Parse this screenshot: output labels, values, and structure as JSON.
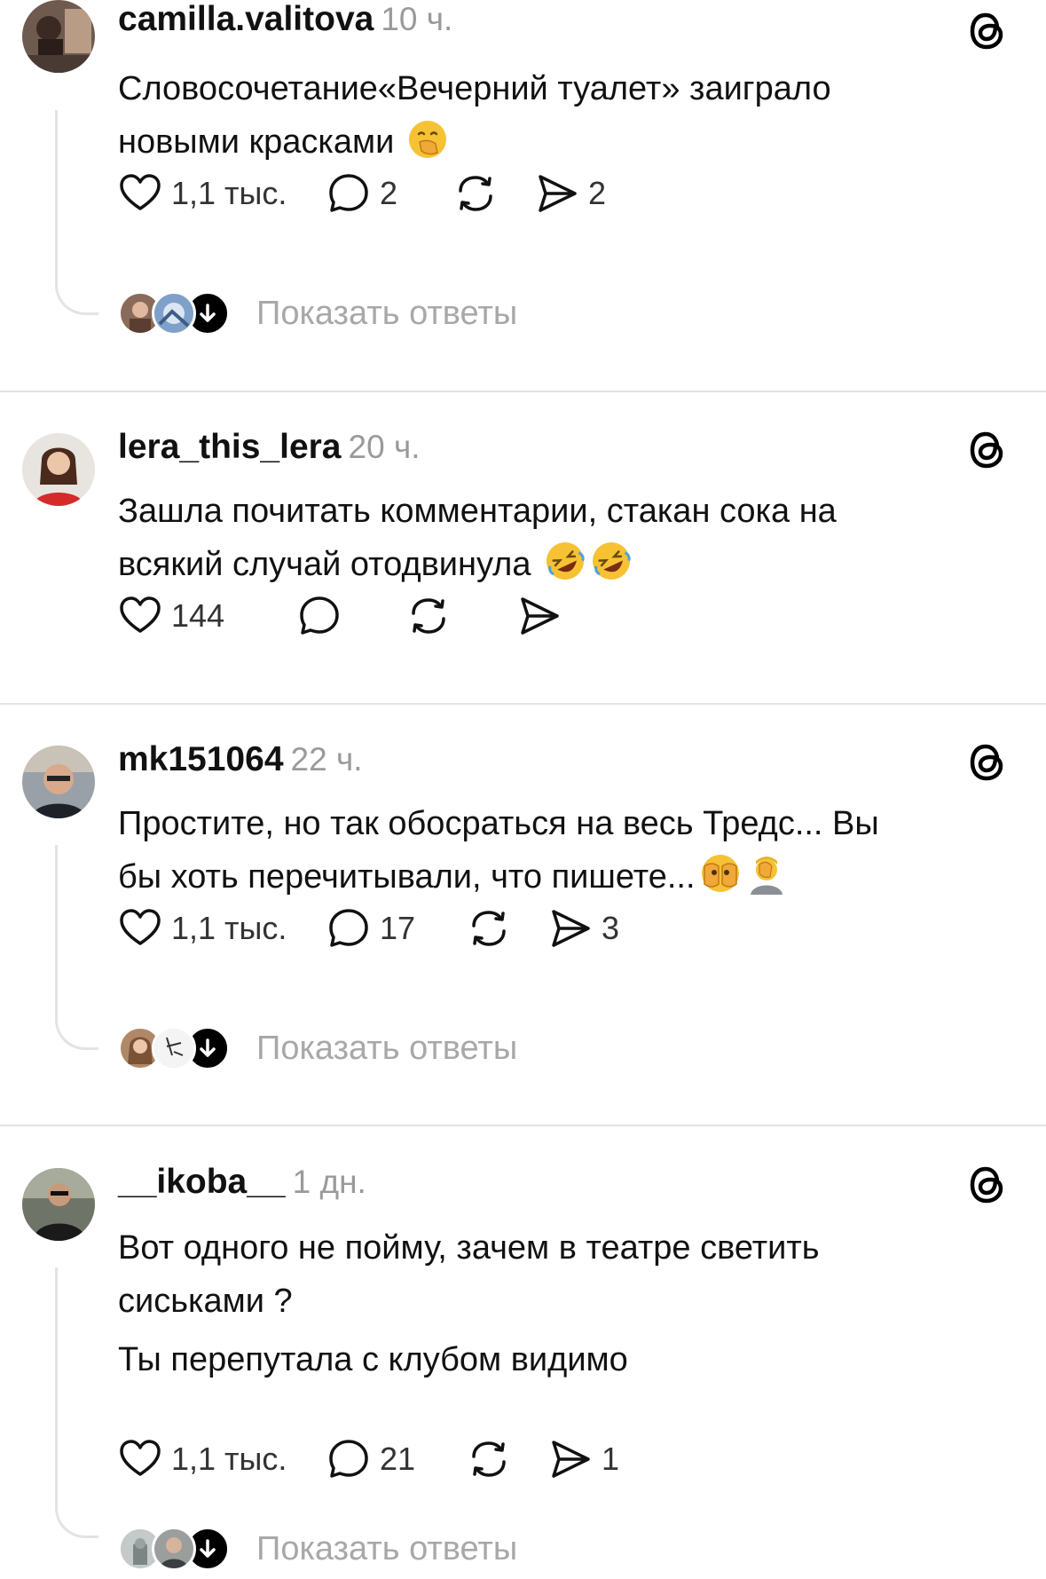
{
  "posts": [
    {
      "username": "camilla.valitova",
      "time": "10 ч.",
      "lines": [
        "Словосочетание«Вечерний туалет» заиграло",
        "новыми красками"
      ],
      "emojis": [
        "hand-over-mouth-emoji"
      ],
      "likes": "1,1 тыс.",
      "comments": "2",
      "reposts": "",
      "shares": "2",
      "show_replies": "Показать ответы"
    },
    {
      "username": "lera_this_lera",
      "time": "20 ч.",
      "lines": [
        "Зашла почитать комментарии, стакан сока на",
        "всякий случай отодвинула"
      ],
      "emojis": [
        "rolling-laughing-emoji",
        "rolling-laughing-emoji"
      ],
      "likes": "144",
      "comments": "",
      "reposts": "",
      "shares": ""
    },
    {
      "username": "mk151064",
      "time": "22 ч.",
      "lines": [
        "Простите, но так обосраться на весь Тредс... Вы",
        "бы хоть перечитывали, что пишете..."
      ],
      "emojis": [
        "face-peeking-emoji",
        "facepalm-emoji"
      ],
      "likes": "1,1 тыс.",
      "comments": "17",
      "reposts": "",
      "shares": "3",
      "show_replies": "Показать ответы"
    },
    {
      "username": "__ikoba__",
      "time": "1 дн.",
      "lines": [
        "Вот одного не пойму, зачем в театре светить",
        "сиськами ?",
        "Ты перепутала с клубом видимо"
      ],
      "emojis": [],
      "likes": "1,1 тыс.",
      "comments": "21",
      "reposts": "",
      "shares": "1",
      "show_replies": "Показать ответы"
    }
  ],
  "icons": {
    "like": "heart-icon",
    "comment": "comment-bubble-icon",
    "repost": "repost-icon",
    "share": "send-icon",
    "brand": "threads-logo-icon",
    "expand": "arrow-down-icon"
  },
  "colors": {
    "text": "#111111",
    "muted": "#9a9a9a",
    "divider": "#e3e3e3",
    "badge": "#000000"
  }
}
